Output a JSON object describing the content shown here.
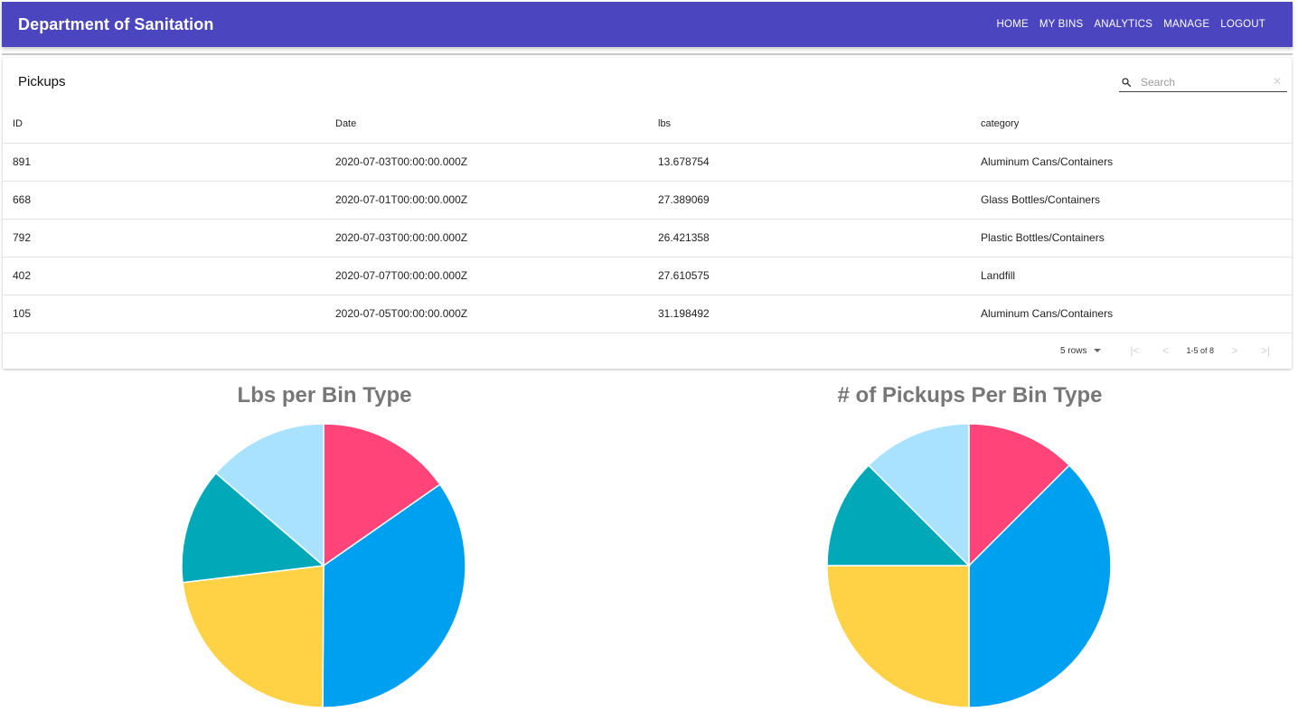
{
  "header": {
    "brand": "Department of Sanitation",
    "nav": [
      "HOME",
      "MY BINS",
      "ANALYTICS",
      "MANAGE",
      "LOGOUT"
    ],
    "color": "#4b45bf"
  },
  "table": {
    "title": "Pickups",
    "search_placeholder": "Search",
    "columns": [
      "ID",
      "Date",
      "lbs",
      "category"
    ],
    "rows": [
      [
        "891",
        "2020-07-03T00:00:00.000Z",
        "13.678754",
        "Aluminum Cans/Containers"
      ],
      [
        "668",
        "2020-07-01T00:00:00.000Z",
        "27.389069",
        "Glass Bottles/Containers"
      ],
      [
        "792",
        "2020-07-03T00:00:00.000Z",
        "26.421358",
        "Plastic Bottles/Containers"
      ],
      [
        "402",
        "2020-07-07T00:00:00.000Z",
        "27.610575",
        "Landfill"
      ],
      [
        "105",
        "2020-07-05T00:00:00.000Z",
        "31.198492",
        "Aluminum Cans/Containers"
      ]
    ],
    "pagination": {
      "rows_label": "5 rows",
      "range": "1-5 of 8"
    }
  },
  "chart_data": [
    {
      "type": "pie",
      "title": "Lbs per Bin Type",
      "values": [
        15.3,
        34.8,
        23.0,
        13.2,
        13.7
      ],
      "colors": [
        "#ff4479",
        "#00a0f0",
        "#ffd144",
        "#00a8b8",
        "#a9e2ff"
      ]
    },
    {
      "type": "pie",
      "title": "# of Pickups Per Bin Type",
      "values": [
        12.5,
        37.5,
        25.0,
        12.5,
        12.5
      ],
      "colors": [
        "#ff4479",
        "#00a0f0",
        "#ffd144",
        "#00a8b8",
        "#a9e2ff"
      ]
    }
  ]
}
